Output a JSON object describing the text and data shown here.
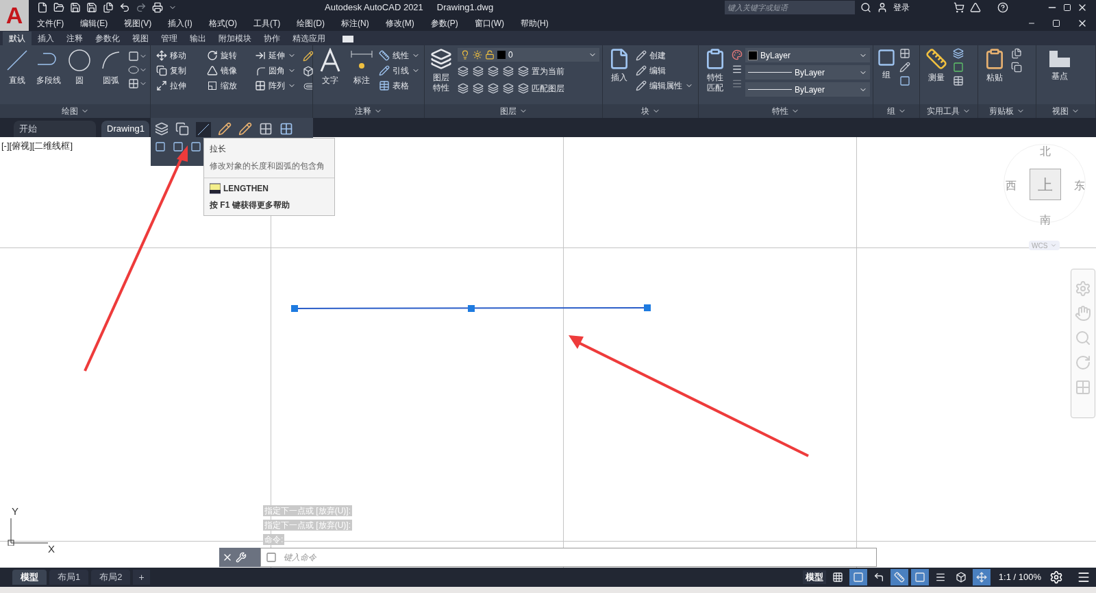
{
  "title_bar": {
    "logo": "A",
    "app_title": "Autodesk AutoCAD 2021",
    "file_name": "Drawing1.dwg",
    "search": {
      "placeholder": "键入关键字或短语"
    },
    "sign_in": "登录"
  },
  "menu_bar": [
    "文件(F)",
    "编辑(E)",
    "视图(V)",
    "插入(I)",
    "格式(O)",
    "工具(T)",
    "绘图(D)",
    "标注(N)",
    "修改(M)",
    "参数(P)",
    "窗口(W)",
    "帮助(H)"
  ],
  "ribbon_tabs": [
    {
      "label": "默认",
      "selected": true
    },
    {
      "label": "插入",
      "selected": false
    },
    {
      "label": "注释",
      "selected": false
    },
    {
      "label": "参数化",
      "selected": false
    },
    {
      "label": "视图",
      "selected": false
    },
    {
      "label": "管理",
      "selected": false
    },
    {
      "label": "输出",
      "selected": false
    },
    {
      "label": "附加模块",
      "selected": false
    },
    {
      "label": "协作",
      "selected": false
    },
    {
      "label": "精选应用",
      "selected": false
    }
  ],
  "draw_panel": {
    "title": "绘图",
    "tools": [
      "直线",
      "多段线",
      "圆",
      "圆弧"
    ]
  },
  "modify_panel": {
    "tools": [
      "移动",
      "旋转",
      "延伸",
      "复制",
      "镜像",
      "圆角",
      "拉伸",
      "缩放",
      "阵列"
    ]
  },
  "annotation_panel": {
    "title": "注释",
    "large_tools": [
      "文字",
      "标注"
    ],
    "small_tools": [
      "线性",
      "引线",
      "表格"
    ]
  },
  "layers_panel": {
    "title": "图层",
    "large_tool": [
      "图层",
      "特性"
    ],
    "layer": "0",
    "small_tools": [
      "置为当前",
      "匹配图层"
    ]
  },
  "block_panel": {
    "title": "块",
    "large_tool": "插入",
    "small_tools": [
      "创建",
      "编辑",
      "编辑属性"
    ]
  },
  "properties_panel": {
    "title": "特性",
    "large_tool": [
      "特性",
      "匹配"
    ],
    "dropdowns": [
      "ByLayer",
      "ByLayer",
      "ByLayer"
    ]
  },
  "group_panel": {
    "title": "组",
    "large_tool": "组"
  },
  "utilities_panel": {
    "title": "实用工具",
    "large_tool": "测量"
  },
  "clipboard_panel": {
    "title": "剪贴板",
    "large_tool": "粘贴"
  },
  "view_panel": {
    "title": "视图",
    "large_tool": "基点"
  },
  "file_tabs": [
    {
      "label": "开始",
      "selected": false
    },
    {
      "label": "Drawing1",
      "selected": true
    }
  ],
  "tooltip": {
    "title": "拉长",
    "description": "修改对象的长度和圆弧的包含角",
    "command": "LENGTHEN",
    "help": "按 F1 键获得更多帮助"
  },
  "viewport_label": "[-][俯视][二维线框]",
  "viewcube": {
    "north": "北",
    "west": "西",
    "face": "上",
    "east": "东",
    "south": "南",
    "ucs": "WCS"
  },
  "ucs_axes": {
    "y": "Y",
    "x": "X"
  },
  "command_history": [
    "指定下一点或 [放弃(U)]:",
    "指定下一点或 [放弃(U)]:",
    "命令:"
  ],
  "command_input": {
    "placeholder": "键入命令"
  },
  "layout_tabs": [
    {
      "label": "模型",
      "selected": true
    },
    {
      "label": "布局1",
      "selected": false
    },
    {
      "label": "布局2",
      "selected": false
    }
  ],
  "add_layout": "+",
  "status_bar": {
    "space": "模型",
    "toggles": [
      {
        "kind": "grid",
        "on": false
      },
      {
        "kind": "snap",
        "on": true
      },
      {
        "kind": "ortho",
        "on": false
      },
      {
        "kind": "polar",
        "on": true
      },
      {
        "kind": "osnap",
        "on": true
      },
      {
        "kind": "lineweight",
        "on": false
      },
      {
        "kind": "iso",
        "on": false
      },
      {
        "kind": "ucs",
        "on": true
      }
    ],
    "scale": "1:1 / 100%"
  }
}
